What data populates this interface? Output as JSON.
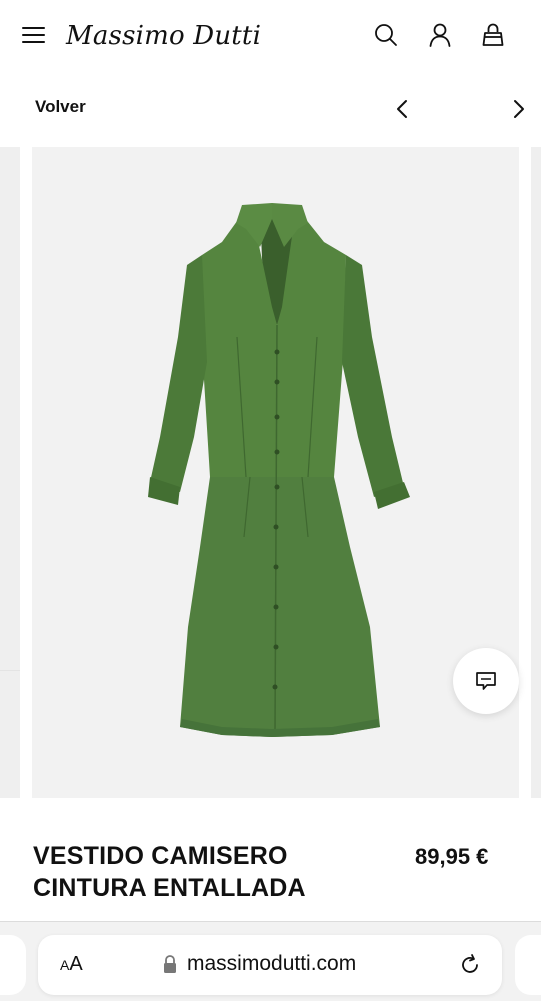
{
  "header": {
    "logo": "Massimo Dutti",
    "icons": [
      "menu-icon",
      "search-icon",
      "account-icon",
      "bag-icon"
    ]
  },
  "subnav": {
    "back_label": "Volver",
    "prev_icon": "chevron-left-icon",
    "next_icon": "chevron-right-icon"
  },
  "gallery": {
    "image": "green-shirt-dress",
    "colors": {
      "dress": "#4f7d3d",
      "dress_shadow": "#3f6830",
      "background": "#f2f2f2"
    },
    "chat_icon": "chat-bubble-icon"
  },
  "product": {
    "title_line1": "VESTIDO CAMISERO",
    "title_line2": "CINTURA ENTALLADA",
    "price": "89,95 €"
  },
  "browser": {
    "aa_small": "A",
    "aa_large": "A",
    "url": "massimodutti.com",
    "lock_icon": "lock-icon",
    "reload_icon": "reload-icon"
  }
}
